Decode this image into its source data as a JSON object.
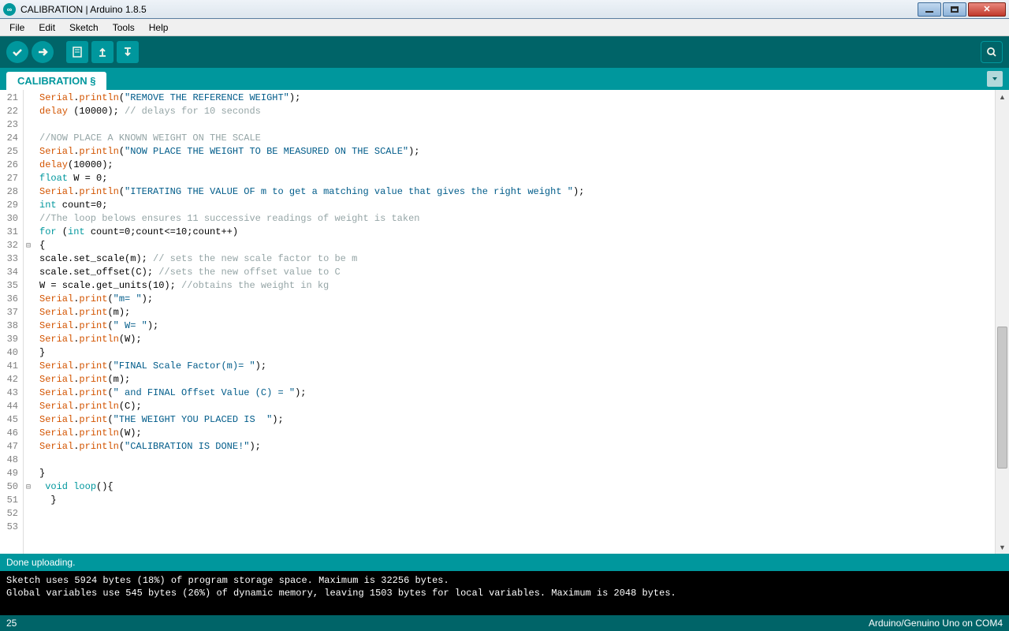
{
  "window": {
    "title": "CALIBRATION | Arduino 1.8.5"
  },
  "menubar": {
    "items": [
      "File",
      "Edit",
      "Sketch",
      "Tools",
      "Help"
    ]
  },
  "tab": {
    "name": "CALIBRATION §"
  },
  "status": {
    "text": "Done uploading."
  },
  "console": {
    "line1": "Sketch uses 5924 bytes (18%) of program storage space. Maximum is 32256 bytes.",
    "line2": "Global variables use 545 bytes (26%) of dynamic memory, leaving 1503 bytes for local variables. Maximum is 2048 bytes."
  },
  "bottombar": {
    "line": "25",
    "board": "Arduino/Genuino Uno on COM4"
  },
  "gutter": {
    "start": 21,
    "end": 53
  },
  "fold_markers": {
    "32": "⊟",
    "50": "⊟"
  },
  "code_lines": [
    {
      "n": 21,
      "h": "<span class='s-k'>Serial</span>.<span class='s-k'>println</span>(<span class='s-s'>\"REMOVE THE REFERENCE WEIGHT\"</span>);"
    },
    {
      "n": 22,
      "h": "<span class='s-k'>delay</span> (10000); <span class='s-c'>// delays for 10 seconds</span>"
    },
    {
      "n": 23,
      "h": ""
    },
    {
      "n": 24,
      "h": "<span class='s-c'>//NOW PLACE A KNOWN WEIGHT ON THE SCALE</span>"
    },
    {
      "n": 25,
      "h": "<span class='s-k'>Serial</span>.<span class='s-k'>println</span>(<span class='s-s'>\"NOW PLACE THE WEIGHT TO BE MEASURED ON THE SCALE\"</span>);"
    },
    {
      "n": 26,
      "h": "<span class='s-k'>delay</span>(10000);"
    },
    {
      "n": 27,
      "h": "<span class='s-t'>float</span> W = 0;"
    },
    {
      "n": 28,
      "h": "<span class='s-k'>Serial</span>.<span class='s-k'>println</span>(<span class='s-s'>\"ITERATING THE VALUE OF m to get a matching value that gives the right weight \"</span>);"
    },
    {
      "n": 29,
      "h": "<span class='s-t'>int</span> count=0;"
    },
    {
      "n": 30,
      "h": "<span class='s-c'>//The loop belows ensures 11 successive readings of weight is taken</span>"
    },
    {
      "n": 31,
      "h": "<span class='s-t'>for</span> (<span class='s-t'>int</span> count=0;count&lt;=10;count++)"
    },
    {
      "n": 32,
      "h": "{"
    },
    {
      "n": 33,
      "h": "scale.set_scale(m); <span class='s-c'>// sets the new scale factor to be m</span>"
    },
    {
      "n": 34,
      "h": "scale.set_offset(C); <span class='s-c'>//sets the new offset value to C</span>"
    },
    {
      "n": 35,
      "h": "W = scale.get_units(10); <span class='s-c'>//obtains the weight in kg</span>"
    },
    {
      "n": 36,
      "h": "<span class='s-k'>Serial</span>.<span class='s-k'>print</span>(<span class='s-s'>\"m= \"</span>);"
    },
    {
      "n": 37,
      "h": "<span class='s-k'>Serial</span>.<span class='s-k'>print</span>(m);"
    },
    {
      "n": 38,
      "h": "<span class='s-k'>Serial</span>.<span class='s-k'>print</span>(<span class='s-s'>\" W= \"</span>);"
    },
    {
      "n": 39,
      "h": "<span class='s-k'>Serial</span>.<span class='s-k'>println</span>(W);"
    },
    {
      "n": 40,
      "h": "}"
    },
    {
      "n": 41,
      "h": "<span class='s-k'>Serial</span>.<span class='s-k'>print</span>(<span class='s-s'>\"FINAL Scale Factor(m)= \"</span>);"
    },
    {
      "n": 42,
      "h": "<span class='s-k'>Serial</span>.<span class='s-k'>print</span>(m);"
    },
    {
      "n": 43,
      "h": "<span class='s-k'>Serial</span>.<span class='s-k'>print</span>(<span class='s-s'>\" and FINAL Offset Value (C) = \"</span>);"
    },
    {
      "n": 44,
      "h": "<span class='s-k'>Serial</span>.<span class='s-k'>println</span>(C);"
    },
    {
      "n": 45,
      "h": "<span class='s-k'>Serial</span>.<span class='s-k'>print</span>(<span class='s-s'>\"THE WEIGHT YOU PLACED IS  \"</span>);"
    },
    {
      "n": 46,
      "h": "<span class='s-k'>Serial</span>.<span class='s-k'>println</span>(W);"
    },
    {
      "n": 47,
      "h": "<span class='s-k'>Serial</span>.<span class='s-k'>println</span>(<span class='s-s'>\"CALIBRATION IS DONE!\"</span>);"
    },
    {
      "n": 48,
      "h": ""
    },
    {
      "n": 49,
      "h": "}"
    },
    {
      "n": 50,
      "h": " <span class='s-t'>void</span> <span class='s-t'>loop</span>(){"
    },
    {
      "n": 51,
      "h": "  }"
    },
    {
      "n": 52,
      "h": ""
    },
    {
      "n": 53,
      "h": ""
    }
  ]
}
